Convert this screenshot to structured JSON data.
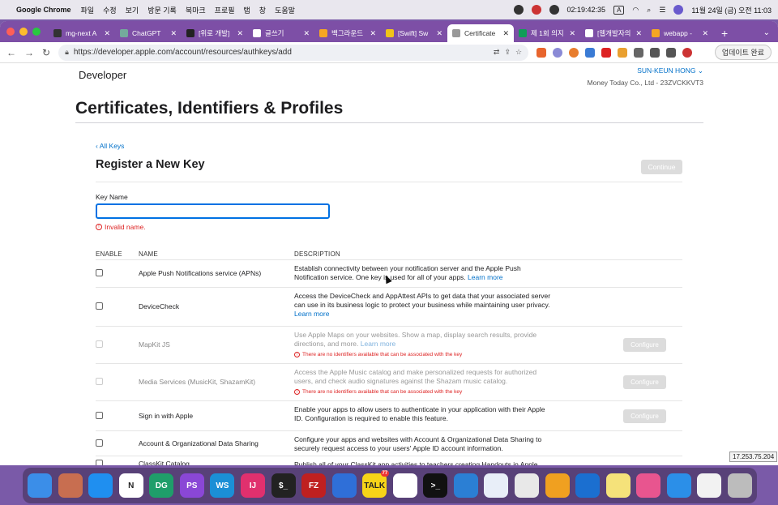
{
  "menubar": {
    "app_name": "Google Chrome",
    "items": [
      "파일",
      "수정",
      "보기",
      "방문 기록",
      "북마크",
      "프로필",
      "탭",
      "창",
      "도움말"
    ],
    "timer": "02:19:42:35",
    "input_indicator": "A",
    "datetime": "11월 24일 (금) 오전 11:03"
  },
  "tabs": [
    {
      "title": "mg-next A",
      "active": false,
      "color": "#333333"
    },
    {
      "title": "ChatGPT",
      "active": false,
      "color": "#74aa9c"
    },
    {
      "title": "[위로 개발]",
      "active": false,
      "color": "#222222"
    },
    {
      "title": "글쓰기",
      "active": false,
      "color": "#ffffff"
    },
    {
      "title": "백그라운드 ..",
      "active": false,
      "color": "#f5a623"
    },
    {
      "title": "[Swift] Sw",
      "active": false,
      "color": "#f0c419"
    },
    {
      "title": "Certificate",
      "active": true,
      "color": "#999999"
    },
    {
      "title": "제 1회 의지",
      "active": false,
      "color": "#0f9d58"
    },
    {
      "title": "[웹개발자의",
      "active": false,
      "color": "#ffffff"
    },
    {
      "title": "webapp -",
      "active": false,
      "color": "#f5a623"
    }
  ],
  "toolbar": {
    "url": "https://developer.apple.com/account/resources/authkeys/add",
    "update_label": "업데이트 완료"
  },
  "header": {
    "logo_text": "Developer",
    "account_name": "SUN-KEUN HONG ⌄",
    "team": "Money Today Co., Ltd - 23ZVCKKVT3",
    "page_title": "Certificates, Identifiers & Profiles"
  },
  "form": {
    "back_link": "‹ All Keys",
    "title": "Register a New Key",
    "continue_label": "Continue",
    "key_name_label": "Key Name",
    "key_name_value": "",
    "error": "Invalid name."
  },
  "table": {
    "columns": [
      "ENABLE",
      "NAME",
      "DESCRIPTION"
    ],
    "rows": [
      {
        "name": "Apple Push Notifications service (APNs)",
        "desc": "Establish connectivity between your notification server and the Apple Push Notification service. One key is used for all of your apps.",
        "link": "Learn more",
        "disabled": false,
        "warning": "",
        "configure": ""
      },
      {
        "name": "DeviceCheck",
        "desc": "Access the DeviceCheck and AppAttest APIs to get data that your associated server can use in its business logic to protect your business while maintaining user privacy.",
        "link": "Learn more",
        "disabled": false,
        "warning": "",
        "configure": ""
      },
      {
        "name": "MapKit JS",
        "desc": "Use Apple Maps on your websites. Show a map, display search results, provide directions, and more.",
        "link": "Learn more",
        "disabled": true,
        "warning": "There are no identifiers available that can be associated with the key",
        "configure": "Configure"
      },
      {
        "name": "Media Services (MusicKit, ShazamKit)",
        "desc": "Access the Apple Music catalog and make personalized requests for authorized users, and check audio signatures against the Shazam music catalog.",
        "link": "",
        "disabled": true,
        "warning": "There are no identifiers available that can be associated with the key",
        "configure": "Configure"
      },
      {
        "name": "Sign in with Apple",
        "desc": "Enable your apps to allow users to authenticate in your application with their Apple ID. Configuration is required to enable this feature.",
        "link": "",
        "disabled": false,
        "warning": "",
        "configure": "Configure"
      },
      {
        "name": "Account & Organizational Data Sharing",
        "desc": "Configure your apps and websites with Account & Organizational Data Sharing to securely request access to your users' Apple ID account information.",
        "link": "",
        "disabled": false,
        "warning": "",
        "configure": ""
      },
      {
        "name": "ClassKit Catalog",
        "desc": "Publish all of your ClassKit app activities to teachers creating Handouts in Apple",
        "link": "",
        "disabled": false,
        "warning": "",
        "configure": ""
      }
    ]
  },
  "ip_badge": "17.253.75.204",
  "dock": [
    {
      "name": "finder-icon",
      "label": "",
      "color": "#3b8ee8",
      "badge": ""
    },
    {
      "name": "launchpad-icon",
      "label": "",
      "color": "#c86e50",
      "badge": ""
    },
    {
      "name": "safari-icon",
      "label": "",
      "color": "#1f8ff0",
      "badge": ""
    },
    {
      "name": "notion-icon",
      "label": "N",
      "color": "#ffffff",
      "badge": ""
    },
    {
      "name": "datagrip-icon",
      "label": "DG",
      "color": "#1f9e6a",
      "badge": ""
    },
    {
      "name": "phpstorm-icon",
      "label": "PS",
      "color": "#8a47d6",
      "badge": ""
    },
    {
      "name": "webstorm-icon",
      "label": "WS",
      "color": "#1b8fd6",
      "badge": ""
    },
    {
      "name": "intellij-icon",
      "label": "IJ",
      "color": "#e0306e",
      "badge": ""
    },
    {
      "name": "terminal-icon",
      "label": "$_",
      "color": "#222222",
      "badge": ""
    },
    {
      "name": "filezilla-icon",
      "label": "FZ",
      "color": "#bf2020",
      "badge": ""
    },
    {
      "name": "fork-icon",
      "label": "",
      "color": "#2f6fd8",
      "badge": ""
    },
    {
      "name": "kakaotalk-icon",
      "label": "TALK",
      "color": "#f7d418",
      "badge": "77"
    },
    {
      "name": "slack-icon",
      "label": "",
      "color": "#ffffff",
      "badge": ""
    },
    {
      "name": "iterm-icon",
      "label": ">_",
      "color": "#111111",
      "badge": ""
    },
    {
      "name": "vscode-icon",
      "label": "",
      "color": "#2b7fd4",
      "badge": ""
    },
    {
      "name": "app-icon",
      "label": "",
      "color": "#e8eef8",
      "badge": ""
    },
    {
      "name": "chrome-icon",
      "label": "",
      "color": "#e8e8e8",
      "badge": ""
    },
    {
      "name": "overflow-icon",
      "label": "",
      "color": "#f0a020",
      "badge": ""
    },
    {
      "name": "outlook-icon",
      "label": "",
      "color": "#1b6fd0",
      "badge": ""
    },
    {
      "name": "notes-icon",
      "label": "",
      "color": "#f5e27a",
      "badge": ""
    },
    {
      "name": "arc-icon",
      "label": "",
      "color": "#e8558f",
      "badge": ""
    },
    {
      "name": "xcode-icon",
      "label": "",
      "color": "#2b8fe8",
      "badge": ""
    },
    {
      "name": "document-icon",
      "label": "",
      "color": "#f2f2f2",
      "badge": ""
    },
    {
      "name": "trash-icon",
      "label": "",
      "color": "#bcbcbc",
      "badge": ""
    }
  ]
}
